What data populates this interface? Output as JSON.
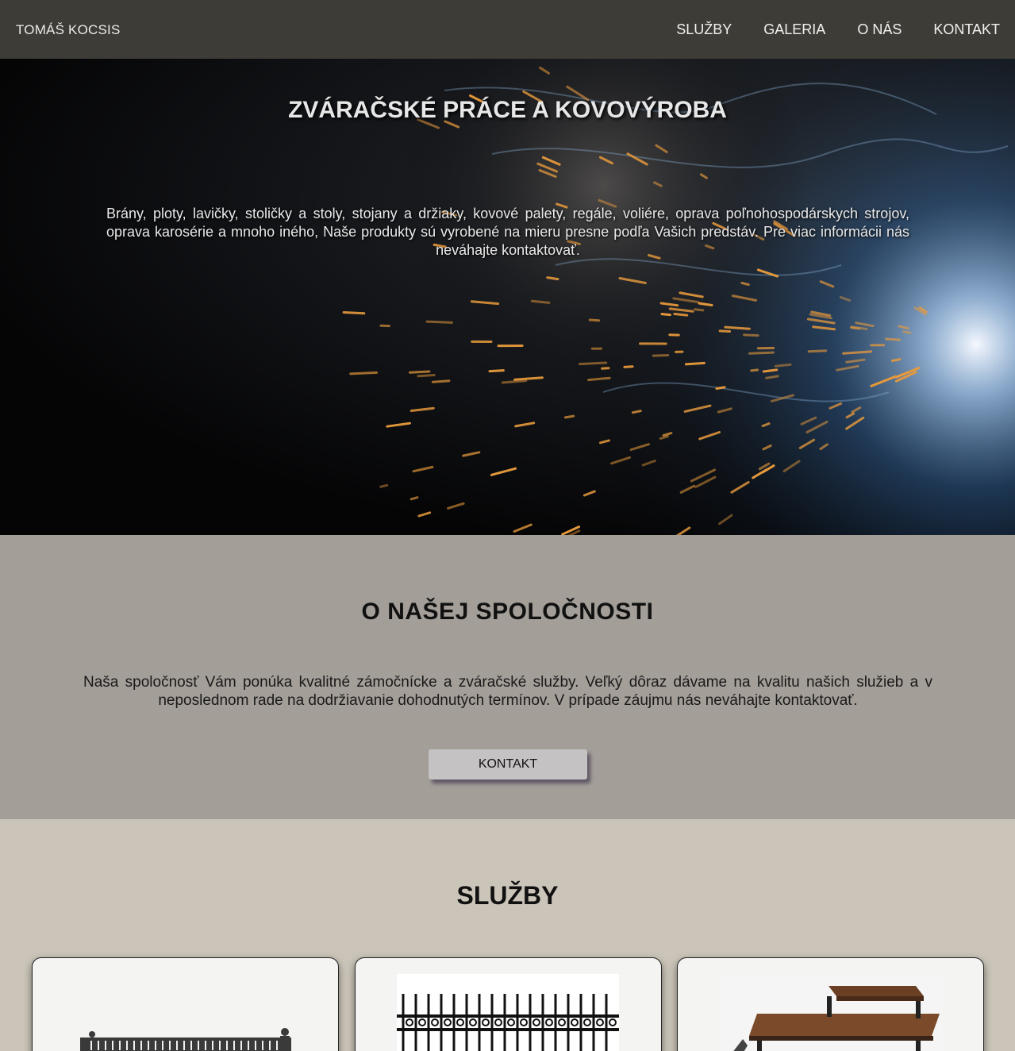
{
  "nav": {
    "brand": "TOMÁŠ KOCSIS",
    "links": [
      "SLUŽBY",
      "GALERIA",
      "O NÁS",
      "KONTAKT"
    ]
  },
  "hero": {
    "title": "ZVÁRAČSKÉ PRÁCE A KOVOVÝROBA",
    "text": "Brány, ploty, lavičky, stoličky a stoly, stojany a držiaky, kovové palety, regále, voliére, oprava poľnohospodárskych strojov, oprava karosérie a mnoho iného, Naše produkty sú vyrobené na mieru presne podľa Vašich predstáv. Pre viac informácii nás neváhajte kontaktovať."
  },
  "about": {
    "title": "O NAŠEJ SPOLOČNOSTI",
    "text": "Naša spoločnosť Vám ponúka kvalitné zámočnícke a zváračské služby. Veľký dôraz dávame na kvalitu našich služieb a v neposlednom rade na dodržiavanie dohodnutých termínov. V prípade záujmu nás neváhajte kontaktovať.",
    "button_label": "KONTAKT"
  },
  "services": {
    "title": "SLUŽBY"
  },
  "colors": {
    "nav_bg": "#3e3c37",
    "about_bg": "#a39e98",
    "services_bg": "#cbc5b9",
    "card_bg": "#f4f4f3"
  }
}
